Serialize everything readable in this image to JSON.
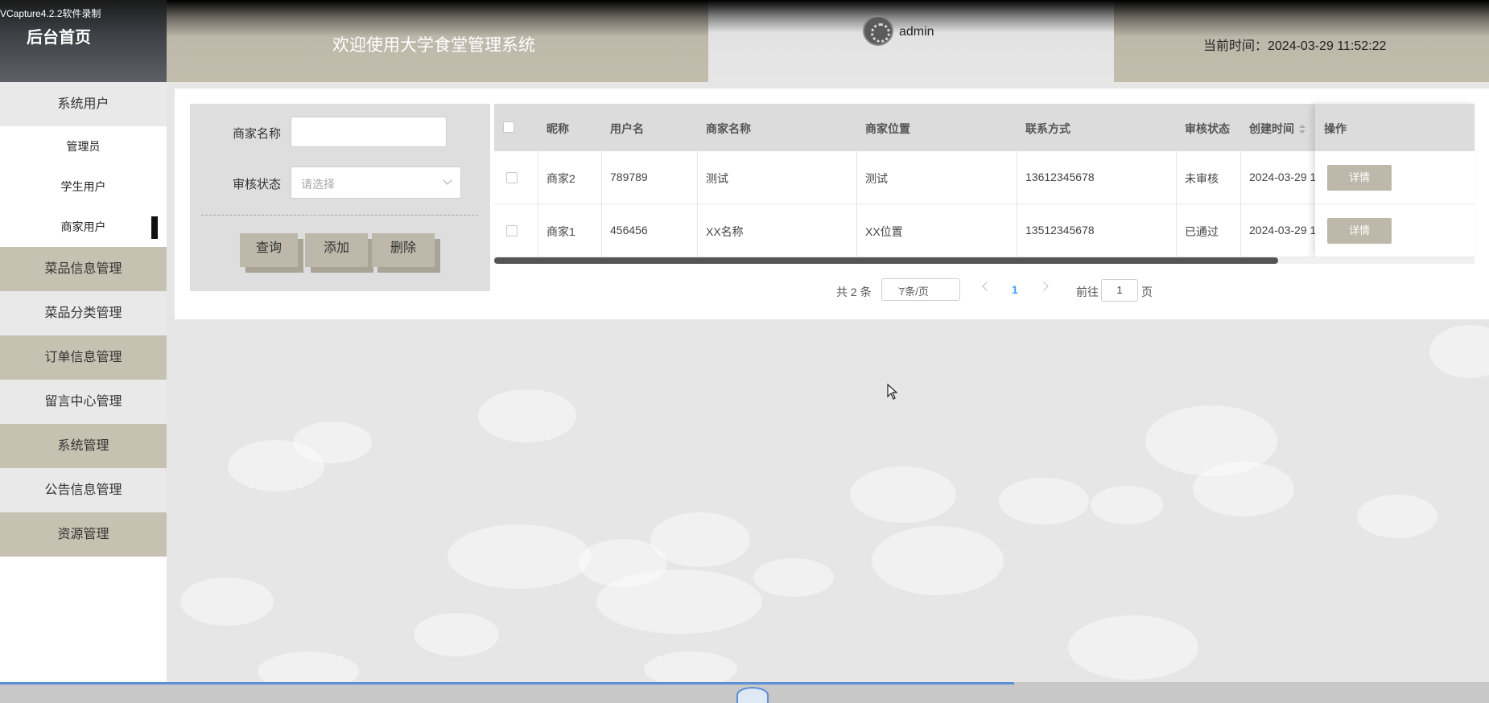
{
  "recorder_watermark": "VCapture4.2.2软件录制",
  "header": {
    "brand": "后台首页",
    "welcome": "欢迎使用大学食堂管理系统",
    "username": "admin",
    "time_label": "当前时间：2024-03-29 11:52:22"
  },
  "sidebar": {
    "items": [
      {
        "label": "系统用户",
        "style": "gray"
      },
      {
        "label": "管理员",
        "sub": true
      },
      {
        "label": "学生用户",
        "sub": true
      },
      {
        "label": "商家用户",
        "sub": true,
        "active": true
      },
      {
        "label": "菜品信息管理",
        "style": "tan"
      },
      {
        "label": "菜品分类管理",
        "style": "gray"
      },
      {
        "label": "订单信息管理",
        "style": "tan"
      },
      {
        "label": "留言中心管理",
        "style": "gray"
      },
      {
        "label": "系统管理",
        "style": "tan"
      },
      {
        "label": "公告信息管理",
        "style": "gray"
      },
      {
        "label": "资源管理",
        "style": "tan"
      }
    ]
  },
  "search": {
    "merchant_name_label": "商家名称",
    "merchant_name_value": "",
    "audit_status_label": "审核状态",
    "audit_status_placeholder": "请选择",
    "query_button": "查询",
    "add_button": "添加",
    "delete_button": "删除"
  },
  "table": {
    "headers": {
      "nickname": "昵称",
      "username": "用户名",
      "merchant_name": "商家名称",
      "merchant_location": "商家位置",
      "contact": "联系方式",
      "audit_status": "审核状态",
      "created_at": "创建时间",
      "actions": "操作"
    },
    "rows": [
      {
        "nickname": "商家2",
        "username": "789789",
        "merchant_name": "测试",
        "merchant_location": "测试",
        "contact": "13612345678",
        "audit_status": "未审核",
        "created_at": "2024-03-29 1",
        "action": "详情"
      },
      {
        "nickname": "商家1",
        "username": "456456",
        "merchant_name": "XX名称",
        "merchant_location": "XX位置",
        "contact": "13512345678",
        "audit_status": "已通过",
        "created_at": "2024-03-29 1",
        "action": "详情"
      }
    ],
    "horizontal_scroll_fraction": 0.8
  },
  "pagination": {
    "total_text": "共 2 条",
    "page_size": "7条/页",
    "current_page": "1",
    "goto_prefix": "前往",
    "goto_value": "1",
    "goto_suffix": "页"
  },
  "colors": {
    "accent_tan": "#bdb8a9",
    "menu_tan": "#c7c1b2",
    "menu_gray": "#e9e9e9",
    "active_page": "#409eff"
  }
}
